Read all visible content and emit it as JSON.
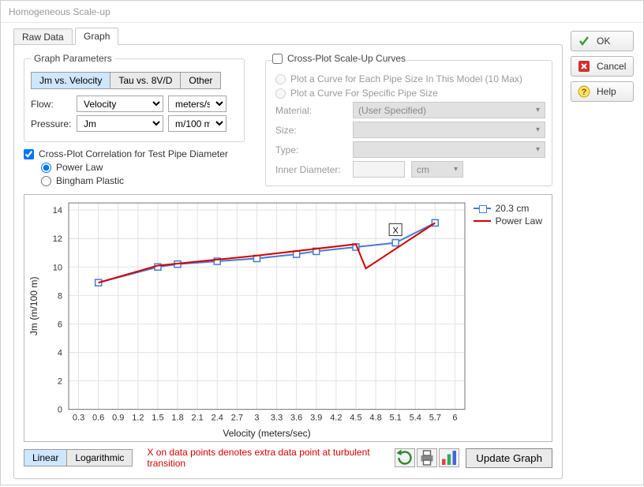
{
  "window_title": "Homogeneous Scale-up",
  "tabs": {
    "raw_data": "Raw Data",
    "graph": "Graph"
  },
  "gparams": {
    "legend": "Graph Parameters",
    "opt1": "Jm vs. Velocity",
    "opt2": "Tau vs. 8V/D",
    "opt3": "Other",
    "flow_label": "Flow:",
    "flow_val": "Velocity",
    "flow_unit": "meters/sec",
    "press_label": "Pressure:",
    "press_val": "Jm",
    "press_unit": "m/100 m"
  },
  "crosscorr": {
    "label": "Cross-Plot Correlation for Test Pipe Diameter",
    "power": "Power Law",
    "bingham": "Bingham Plastic"
  },
  "crossup": {
    "title": "Cross-Plot Scale-Up Curves",
    "r1": "Plot a Curve for Each Pipe Size In This Model (10 Max)",
    "r2": "Plot a Curve For Specific Pipe Size",
    "material_l": "Material:",
    "material_v": "(User Specified)",
    "size_l": "Size:",
    "type_l": "Type:",
    "idiam_l": "Inner Diameter:",
    "idiam_unit": "cm"
  },
  "chart_data": {
    "type": "line",
    "xlabel": "Velocity (meters/sec)",
    "ylabel": "Jm (m/100 m)",
    "xticks": [
      0.3,
      0.6,
      0.9,
      1.2,
      1.5,
      1.8,
      2.1,
      2.4,
      2.7,
      3,
      3.3,
      3.6,
      3.9,
      4.2,
      4.5,
      4.8,
      5.1,
      5.4,
      5.7,
      6
    ],
    "yticks": [
      0,
      2,
      4,
      6,
      8,
      10,
      12,
      14
    ],
    "xlim": [
      0.15,
      6.15
    ],
    "ylim": [
      0,
      14.5
    ],
    "series": [
      {
        "name": "20.3 cm",
        "color": "#4b7bd1",
        "marker": "square",
        "x": [
          0.6,
          1.5,
          1.8,
          2.4,
          3.0,
          3.6,
          3.9,
          4.5,
          5.1,
          5.7
        ],
        "y": [
          8.9,
          10.0,
          10.2,
          10.4,
          10.6,
          10.9,
          11.1,
          11.4,
          11.7,
          13.1
        ],
        "markX": 5.1
      },
      {
        "name": "Power Law",
        "color": "#d40000",
        "marker": "none",
        "x": [
          0.6,
          1.5,
          3.0,
          4.5,
          4.65,
          5.7
        ],
        "y": [
          8.9,
          10.1,
          10.8,
          11.6,
          9.9,
          13.1
        ]
      }
    ]
  },
  "bottom": {
    "linear": "Linear",
    "log": "Logarithmic",
    "note": "X on data points denotes extra data point at turbulent transition",
    "update": "Update Graph"
  },
  "side": {
    "ok": "OK",
    "cancel": "Cancel",
    "help": "Help"
  }
}
